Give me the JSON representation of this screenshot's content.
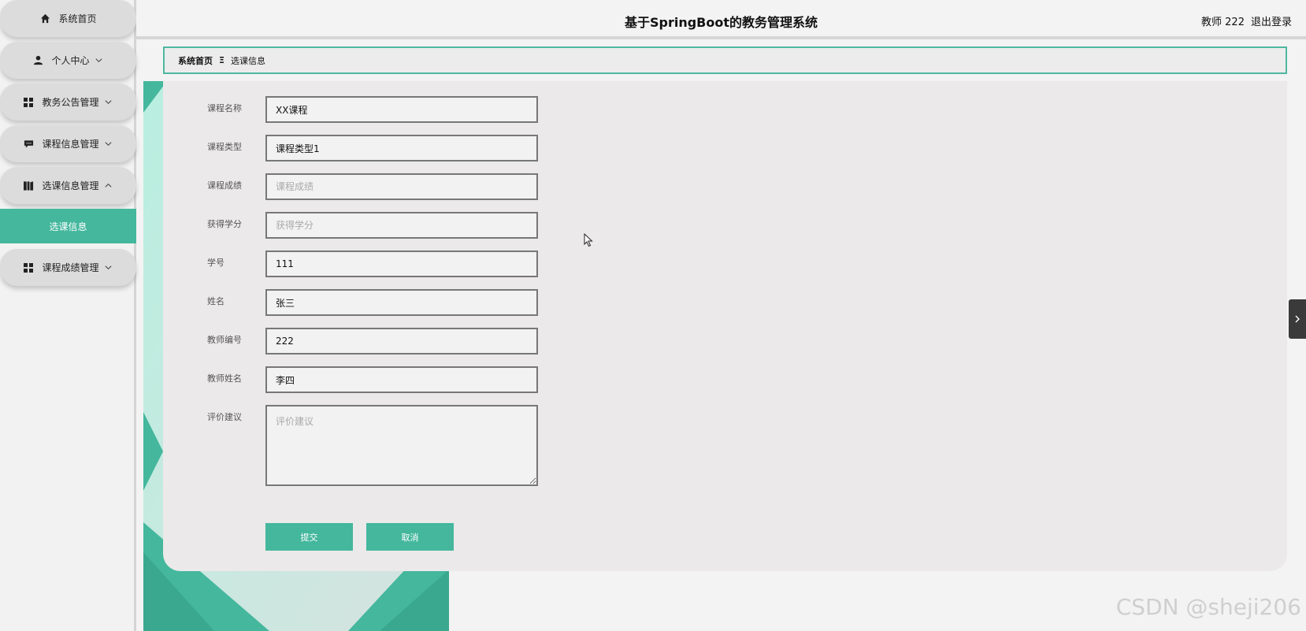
{
  "header": {
    "title": "基于SpringBoot的教务管理系统",
    "user_label": "教师 222",
    "logout_label": "退出登录"
  },
  "sidebar": {
    "items": [
      {
        "label": "系统首页",
        "icon": "home-icon",
        "arrow": ""
      },
      {
        "label": "个人中心",
        "icon": "user-icon",
        "arrow": "down"
      },
      {
        "label": "教务公告管理",
        "icon": "grid-icon",
        "arrow": "down"
      },
      {
        "label": "课程信息管理",
        "icon": "message-icon",
        "arrow": "down"
      },
      {
        "label": "选课信息管理",
        "icon": "book-icon",
        "arrow": "up"
      },
      {
        "label": "课程成绩管理",
        "icon": "grid-icon",
        "arrow": "down"
      }
    ],
    "submenu_active": "选课信息"
  },
  "breadcrumb": {
    "home": "系统首页",
    "separator": "Ξ",
    "current": "选课信息"
  },
  "form": {
    "fields": [
      {
        "label": "课程名称",
        "value": "XX课程",
        "placeholder": "课程名称"
      },
      {
        "label": "课程类型",
        "value": "课程类型1",
        "placeholder": "课程类型"
      },
      {
        "label": "课程成绩",
        "value": "",
        "placeholder": "课程成绩"
      },
      {
        "label": "获得学分",
        "value": "",
        "placeholder": "获得学分"
      },
      {
        "label": "学号",
        "value": "111",
        "placeholder": "学号"
      },
      {
        "label": "姓名",
        "value": "张三",
        "placeholder": "姓名"
      },
      {
        "label": "教师编号",
        "value": "222",
        "placeholder": "教师编号"
      },
      {
        "label": "教师姓名",
        "value": "李四",
        "placeholder": "教师姓名"
      }
    ],
    "textarea": {
      "label": "评价建议",
      "value": "",
      "placeholder": "评价建议"
    },
    "submit_label": "提交",
    "cancel_label": "取消"
  },
  "watermark": "CSDN @sheji206",
  "colors": {
    "accent": "#44b79d",
    "sidebar_item_bg": "#dcdcdc",
    "panel_bg": "#ebe9e9"
  }
}
